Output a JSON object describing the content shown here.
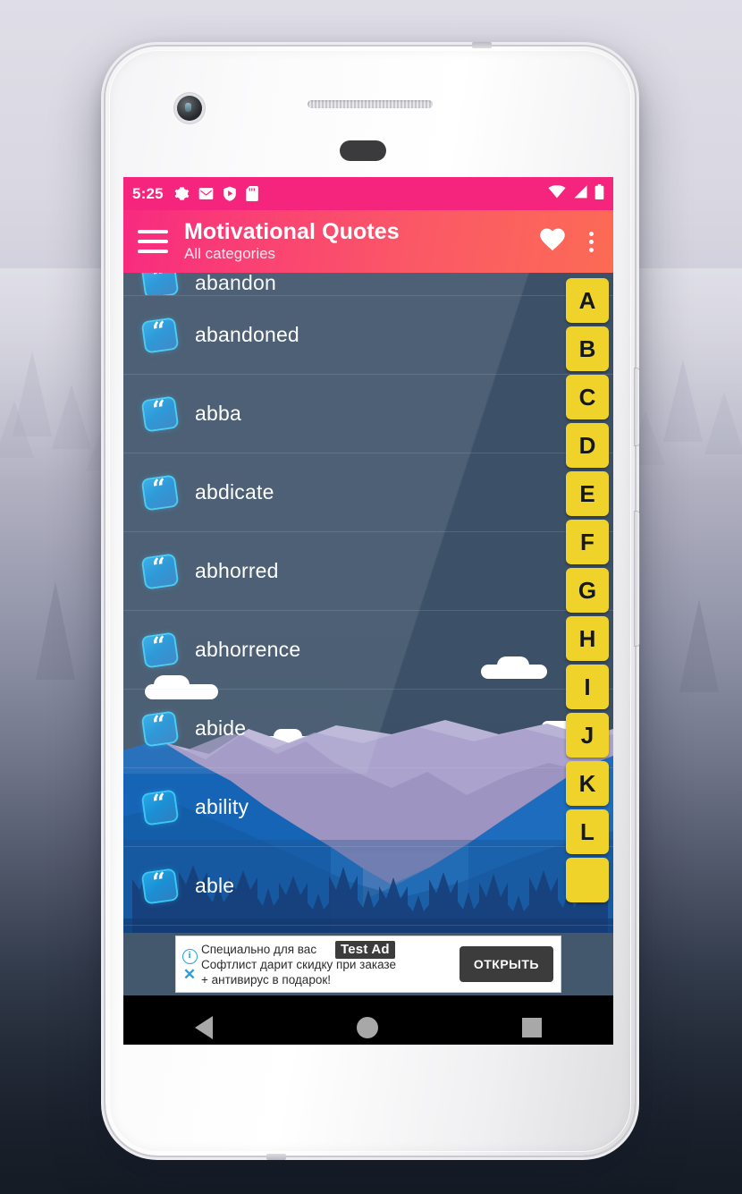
{
  "status_bar": {
    "time": "5:25",
    "left_icons": [
      "settings-gear-icon",
      "gmail-icon",
      "play-protect-icon",
      "sd-card-icon"
    ],
    "right_icons": [
      "wifi-icon",
      "cell-signal-icon",
      "battery-icon"
    ]
  },
  "app_bar": {
    "title": "Motivational Quotes",
    "subtitle": "All categories",
    "menu_icon": "hamburger-menu-icon",
    "favorite_icon": "heart-icon",
    "overflow_icon": "more-vertical-icon",
    "accent_start": "#f82a80",
    "accent_end": "#fc6b55"
  },
  "list": {
    "partial_top_item": "abandon",
    "items": [
      {
        "label": "abandoned"
      },
      {
        "label": "abba"
      },
      {
        "label": "abdicate"
      },
      {
        "label": "abhorred"
      },
      {
        "label": "abhorrence"
      },
      {
        "label": "abide"
      },
      {
        "label": "ability"
      },
      {
        "label": "able"
      }
    ],
    "item_icon": "quote-mark-icon",
    "quote_glyph": "“"
  },
  "alpha_index": {
    "letters": [
      "A",
      "B",
      "C",
      "D",
      "E",
      "F",
      "G",
      "H",
      "I",
      "J",
      "K",
      "L",
      ""
    ],
    "tile_color": "#f0d32a",
    "text_color": "#14181d"
  },
  "ad": {
    "badge": "Test Ad",
    "line1": "Специально для вас",
    "line2": "Софтлист дарит скидку при заказе",
    "line3": "+ антивирус в подарок!",
    "cta": "ОТКРЫТЬ",
    "info_icon": "info-icon",
    "info_glyph": "i",
    "close_icon": "close-x-icon",
    "close_glyph": "✕"
  },
  "nav_bar": {
    "back": "back-triangle-icon",
    "home": "home-circle-icon",
    "recents": "recents-square-icon"
  }
}
